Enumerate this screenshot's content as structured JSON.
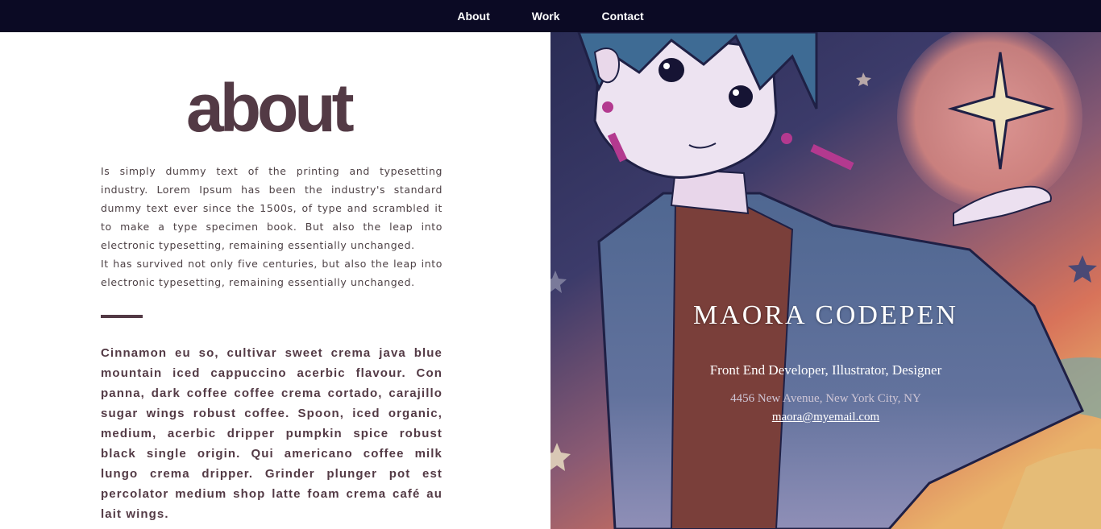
{
  "nav": {
    "items": [
      {
        "label": "About"
      },
      {
        "label": "Work"
      },
      {
        "label": "Contact"
      }
    ]
  },
  "about": {
    "heading": "about",
    "intro_paragraphs": [
      "Is simply dummy text of the printing and typesetting industry. Lorem Ipsum has been the industry's standard dummy text ever since the 1500s, of type and scrambled it to make a type specimen book. But also the leap into electronic typesetting, remaining essentially unchanged.",
      "It has survived not only five centuries, but also the leap into electronic typesetting, remaining essentially unchanged."
    ],
    "body_text": "Cinnamon eu so, cultivar sweet crema java blue mountain iced cappuccino acerbic flavour. Con panna, dark coffee coffee crema cortado, carajillo sugar wings robust coffee. Spoon, iced organic, medium, acerbic dripper pumpkin spice robust black single origin. Qui americano coffee milk lungo crema dripper. Grinder plunger pot est percolator medium shop latte foam crema café au lait wings."
  },
  "profile": {
    "name": "MAORA CODEPEN",
    "role": "Front End Developer, Illustrator, Designer",
    "address": "4456 New Avenue, New York City, NY",
    "email": "maora@myemail.com"
  },
  "colors": {
    "nav_background": "#0b0a24",
    "accent": "#533a45",
    "text": "#4d4145"
  },
  "illustration": {
    "icons": [
      "character-illustration",
      "sparkle-star-icon",
      "star-icon"
    ]
  }
}
